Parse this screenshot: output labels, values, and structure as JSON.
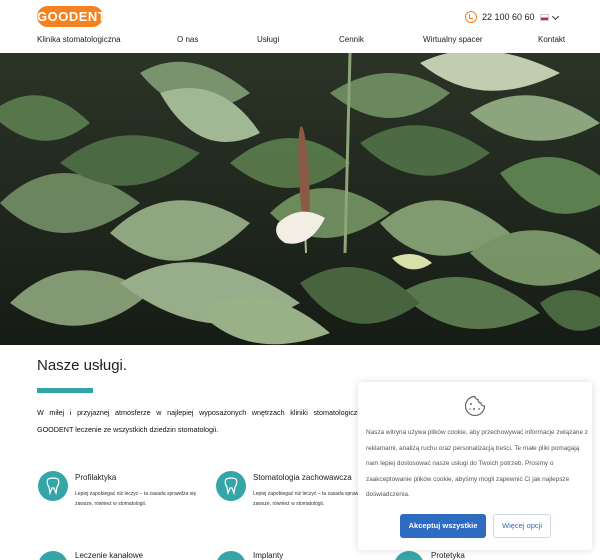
{
  "header": {
    "logo_text": "GOODENT",
    "phone": "22 100 60 60",
    "language_flag": "pl-flag"
  },
  "nav": {
    "items": [
      {
        "label": "Klinika stomatologiczna"
      },
      {
        "label": "O nas"
      },
      {
        "label": "Usługi"
      },
      {
        "label": "Cennik"
      },
      {
        "label": "Wirtualny spacer"
      },
      {
        "label": "Kontakt"
      }
    ]
  },
  "services": {
    "title": "Nasze usługi.",
    "intro": "W miłej i przyjaznej atmosferze w najlepiej wyposażonych wnętrzach kliniki stomatologicznej GOODENT leczenie ze wszystkich dziedzin stomatologii.",
    "items": [
      {
        "title": "Profilaktyka",
        "desc": "Lepiej zapobiegać niż leczyć – ta zasada sprawdza się zawsze, również w stomatologii."
      },
      {
        "title": "Stomatologia zachowawcza",
        "desc": "Lepiej zapobiegać niż leczyć – ta zasada sprawdza się zawsze, również w stomatologii."
      },
      {
        "title": "Leczenie kanałowe",
        "desc": ""
      },
      {
        "title": "Implanty",
        "desc": ""
      },
      {
        "title": "Protetyka",
        "desc": ""
      }
    ]
  },
  "cookie": {
    "text": "Nasza witryna używa plików cookie, aby przechowywać informacje związane z reklamami, analizą ruchu oraz personalizacją treści. Te małe pliki pomagają nam lepiej dostosować nasze usługi do Twoich potrzeb. Prosimy o zaakceptowanie plików cookie, abyśmy mogli zapewnić Ci jak najlepsze doświadczenia.",
    "accept_label": "Akceptuj wszystkie",
    "more_label": "Więcej opcji"
  },
  "colors": {
    "brand_orange": "#f58220",
    "teal": "#35a5a7",
    "button_blue": "#2d6cc0"
  }
}
